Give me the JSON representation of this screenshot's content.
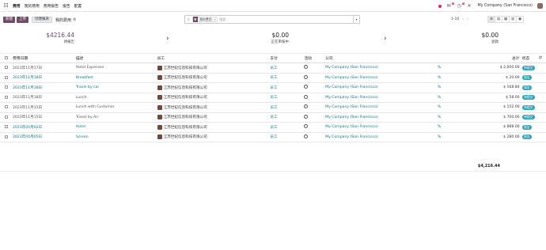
{
  "topbar": {
    "menu": [
      "费用",
      "我的费用",
      "费用报告",
      "报告",
      "配置"
    ],
    "badge_messages": "4",
    "badge_activities": "5",
    "company": "My Company (San Francisco)"
  },
  "control": {
    "new_label": "新建",
    "upload_label": "上传",
    "create_report_label": "创建报表",
    "breadcrumb": "我的费用",
    "facet_value": "我的费用",
    "search_placeholder": "搜索...",
    "pager": "1-10",
    "views": [
      "≡",
      "▤",
      "▦",
      "▥",
      "▣"
    ]
  },
  "summary": [
    {
      "amount": "$4216.44",
      "label": "待报告",
      "accent": true
    },
    {
      "amount": "$0.00",
      "label": "正在审核中",
      "accent": false
    },
    {
      "amount": "$0.00",
      "label": "退款",
      "accent": false
    }
  ],
  "columns": {
    "date": "费用日期",
    "description": "描述",
    "employee": "员工",
    "paid_by": "支付",
    "activity": "活动",
    "company": "公司",
    "total": "总计",
    "status": "状态"
  },
  "rows": [
    {
      "date": "2023年11月17日",
      "description": "Hotel Expenses",
      "employee": "江苏世纪信息科技有限公司",
      "paid_by": "员工",
      "company": "My Company (San Francisco)",
      "percent": "%",
      "total": "$ 2,000.00",
      "status": "待提交",
      "link": false
    },
    {
      "date": "2023年11月18日",
      "description": "Breakfast",
      "employee": "江苏世纪信息科技有限公司",
      "paid_by": "员工",
      "company": "My Company (San Francisco)",
      "percent": "%",
      "total": "$ 20.00",
      "status": "报告",
      "link": true
    },
    {
      "date": "2023年11月18日",
      "description": "Travel by car",
      "employee": "江苏世纪信息科技有限公司",
      "paid_by": "员工",
      "company": "My Company (San Francisco)",
      "percent": "%",
      "total": "$ 168.84",
      "status": "报告",
      "link": true
    },
    {
      "date": "2023年11月18日",
      "description": "Lunch",
      "employee": "江苏世纪信息科技有限公司",
      "paid_by": "员工",
      "company": "My Company (San Francisco)",
      "percent": "%",
      "total": "$ 58.00",
      "status": "待提交",
      "link": false
    },
    {
      "date": "2023年11月15日",
      "description": "Lunch with Customer",
      "employee": "江苏世纪信息科技有限公司",
      "paid_by": "员工",
      "company": "My Company (San Francisco)",
      "percent": "%",
      "total": "$ 152.00",
      "status": "待提交",
      "link": false
    },
    {
      "date": "2023年11月15日",
      "description": "Travel by Air",
      "employee": "江苏世纪信息科技有限公司",
      "paid_by": "员工",
      "company": "My Company (San Francisco)",
      "percent": "%",
      "total": "$ 700.00",
      "status": "待提交",
      "link": false
    },
    {
      "date": "2023年05月02日",
      "description": "Hotel",
      "employee": "江苏世纪信息科技有限公司",
      "paid_by": "员工",
      "company": "My Company (San Francisco)",
      "percent": "%",
      "total": "$ 888.00",
      "status": "报告",
      "link": true
    },
    {
      "date": "2023年04月05日",
      "description": "Screen",
      "employee": "江苏世纪信息科技有限公司",
      "paid_by": "员工",
      "company": "My Company (San Francisco)",
      "percent": "%",
      "total": "$ 280.00",
      "status": "报告",
      "link": true
    }
  ],
  "grand_total": "$4,216.44",
  "colors": {
    "brand": "#714b67",
    "teal": "#2ba2b8",
    "link": "#0a7c8a"
  }
}
